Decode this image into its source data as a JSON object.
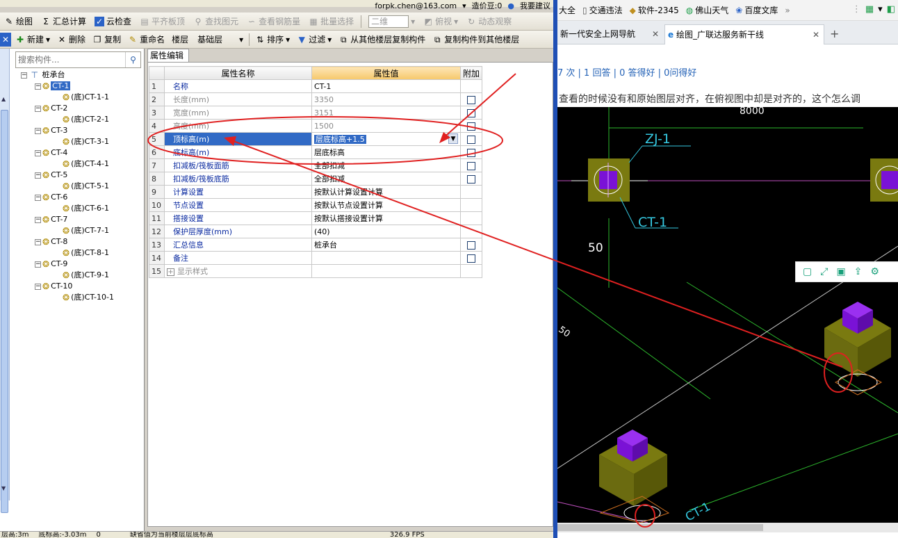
{
  "top_right_info": {
    "email": "forpk.chen@163.com",
    "price_label": "造价豆:0",
    "feedback": "我要建议"
  },
  "toolbar1": {
    "draw": "绘图",
    "summary": "汇总计算",
    "cloud_check": "云检查",
    "flat_top": "平齐板顶",
    "find_elem": "查找图元",
    "view_rebar": "查看钢筋量",
    "batch_select": "批量选择",
    "view_mode": "二维",
    "top_view": "俯视",
    "dynamic_view": "动态观察"
  },
  "toolbar2": {
    "close": "✕",
    "new": "新建",
    "delete": "删除",
    "copy": "复制",
    "rename": "重命名",
    "floor_label": "楼层",
    "floor_value": "基础层",
    "sort": "排序",
    "filter": "过滤",
    "copy_from": "从其他楼层复制构件",
    "copy_to": "复制构件到其他楼层"
  },
  "search": {
    "placeholder": "搜索构件..."
  },
  "tree": {
    "root": "桩承台",
    "items": [
      {
        "name": "CT-1",
        "child": "(底)CT-1-1"
      },
      {
        "name": "CT-2",
        "child": "(底)CT-2-1"
      },
      {
        "name": "CT-3",
        "child": "(底)CT-3-1"
      },
      {
        "name": "CT-4",
        "child": "(底)CT-4-1"
      },
      {
        "name": "CT-5",
        "child": "(底)CT-5-1"
      },
      {
        "name": "CT-6",
        "child": "(底)CT-6-1"
      },
      {
        "name": "CT-7",
        "child": "(底)CT-7-1"
      },
      {
        "name": "CT-8",
        "child": "(底)CT-8-1"
      },
      {
        "name": "CT-9",
        "child": "(底)CT-9-1"
      },
      {
        "name": "CT-10",
        "child": "(底)CT-10-1"
      }
    ]
  },
  "property_panel": {
    "tab": "属性编辑",
    "headers": {
      "name": "属性名称",
      "value": "属性值",
      "extra": "附加"
    },
    "rows": [
      {
        "n": "1",
        "name": "名称",
        "value": "CT-1",
        "dim": false,
        "check": false
      },
      {
        "n": "2",
        "name": "长度(mm)",
        "value": "3350",
        "dim": true,
        "check": true
      },
      {
        "n": "3",
        "name": "宽度(mm)",
        "value": "3151",
        "dim": true,
        "check": true
      },
      {
        "n": "4",
        "name": "高度(mm)",
        "value": "1500",
        "dim": true,
        "check": true
      },
      {
        "n": "5",
        "name": "顶标高(m)",
        "value": "层底标高+1.5",
        "dim": false,
        "check": true
      },
      {
        "n": "6",
        "name": "底标高(m)",
        "value": "层底标高",
        "dim": false,
        "check": true
      },
      {
        "n": "7",
        "name": "扣减板/筏板面筋",
        "value": "全部扣减",
        "dim": false,
        "check": true
      },
      {
        "n": "8",
        "name": "扣减板/筏板底筋",
        "value": "全部扣减",
        "dim": false,
        "check": true
      },
      {
        "n": "9",
        "name": "计算设置",
        "value": "按默认计算设置计算",
        "dim": false,
        "check": false
      },
      {
        "n": "10",
        "name": "节点设置",
        "value": "按默认节点设置计算",
        "dim": false,
        "check": false
      },
      {
        "n": "11",
        "name": "搭接设置",
        "value": "按默认搭接设置计算",
        "dim": false,
        "check": false
      },
      {
        "n": "12",
        "name": "保护层厚度(mm)",
        "value": "(40)",
        "dim": false,
        "check": false
      },
      {
        "n": "13",
        "name": "汇总信息",
        "value": "桩承台",
        "dim": false,
        "check": true
      },
      {
        "n": "14",
        "name": "备注",
        "value": "",
        "dim": false,
        "check": true
      },
      {
        "n": "15",
        "name": "显示样式",
        "value": "",
        "dim": true,
        "check": false
      }
    ]
  },
  "status_bar": {
    "floor_height": "层高:3m",
    "floor_bottom": "底标高:-3.03m",
    "zero": "0",
    "hint": "缺省值为当前楼层层底标高",
    "fps": "326.9 FPS"
  },
  "browser": {
    "bookmarks": [
      "大全",
      "交通违法",
      "软件-2345",
      "佛山天气",
      "百度文库"
    ],
    "more": "»",
    "tabs": [
      {
        "label": "新一代安全上网导航"
      },
      {
        "label": "绘图_广联达服务新干线"
      }
    ],
    "stats": "7 次 | 1 回答 | 0 答得好 | 0问得好",
    "question": "查看的时候没有和原始图层对齐，在俯视图中却是对齐的，这个怎么调"
  },
  "cad": {
    "dim_top": "8000",
    "label_zj": "ZJ-1",
    "label_ct": "CT-1",
    "dim_left": "50",
    "label_ct_rot": "CT-1",
    "label_50_rot": "50"
  },
  "colors": {
    "selection": "#316ac5",
    "annotation": "#e02020",
    "cad_label": "#35c8e0",
    "cap": "#6b6b10",
    "pile": "#7a12d6"
  }
}
